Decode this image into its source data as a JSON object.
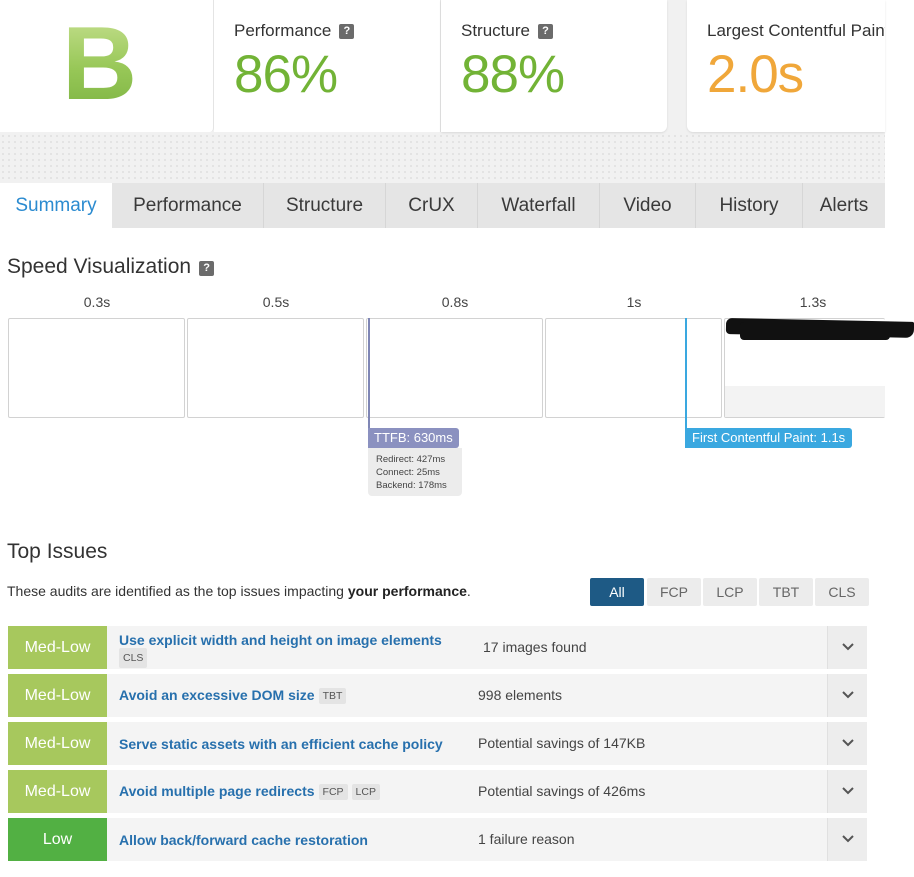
{
  "grade": {
    "letter": "B",
    "color": "#8fc24b"
  },
  "metrics": [
    {
      "label": "Performance",
      "value": "86%",
      "help": "?",
      "color": "#72b336"
    },
    {
      "label": "Structure",
      "value": "88%",
      "help": "?",
      "color": "#72b336"
    },
    {
      "label": "Largest Contentful Paint",
      "value": "2.0s",
      "color": "#f0a73a"
    }
  ],
  "tabs": [
    "Summary",
    "Performance",
    "Structure",
    "CrUX",
    "Waterfall",
    "Video",
    "History",
    "Alerts"
  ],
  "active_tab": "Summary",
  "speed_visualization": {
    "title": "Speed Visualization",
    "help": "?",
    "times": [
      "0.3s",
      "0.5s",
      "0.8s",
      "1s",
      "1.3s"
    ],
    "ttfb": {
      "label": "TTFB: 630ms",
      "redirect": "Redirect: 427ms",
      "connect": "Connect: 25ms",
      "backend": "Backend: 178ms"
    },
    "fcp": {
      "label": "First Contentful Paint: 1.1s"
    }
  },
  "top_issues": {
    "title": "Top Issues",
    "description_prefix": "These audits are identified as the top issues impacting ",
    "description_bold": "your performance",
    "description_suffix": ".",
    "filters": [
      "All",
      "FCP",
      "LCP",
      "TBT",
      "CLS"
    ],
    "active_filter": "All",
    "items": [
      {
        "severity": "Med-Low",
        "title": "Use explicit width and height on image elements",
        "tags": [
          "CLS"
        ],
        "value": "17 images found"
      },
      {
        "severity": "Med-Low",
        "title": "Avoid an excessive DOM size",
        "tags": [
          "TBT"
        ],
        "value": "998 elements"
      },
      {
        "severity": "Med-Low",
        "title": "Serve static assets with an efficient cache policy",
        "tags": [],
        "value": "Potential savings of 147KB"
      },
      {
        "severity": "Med-Low",
        "title": "Avoid multiple page redirects",
        "tags": [
          "FCP",
          "LCP"
        ],
        "value": "Potential savings of 426ms"
      },
      {
        "severity": "Low",
        "title": "Allow back/forward cache restoration",
        "tags": [],
        "value": "1 failure reason"
      }
    ]
  },
  "colors": {
    "accent_blue": "#2b8bd0",
    "link_blue": "#2770ad",
    "filter_active": "#1e5a85",
    "med_low": "#a7c85d",
    "low": "#52b043",
    "ttfb": "#8b91c0",
    "fcp": "#3aa8e0"
  }
}
